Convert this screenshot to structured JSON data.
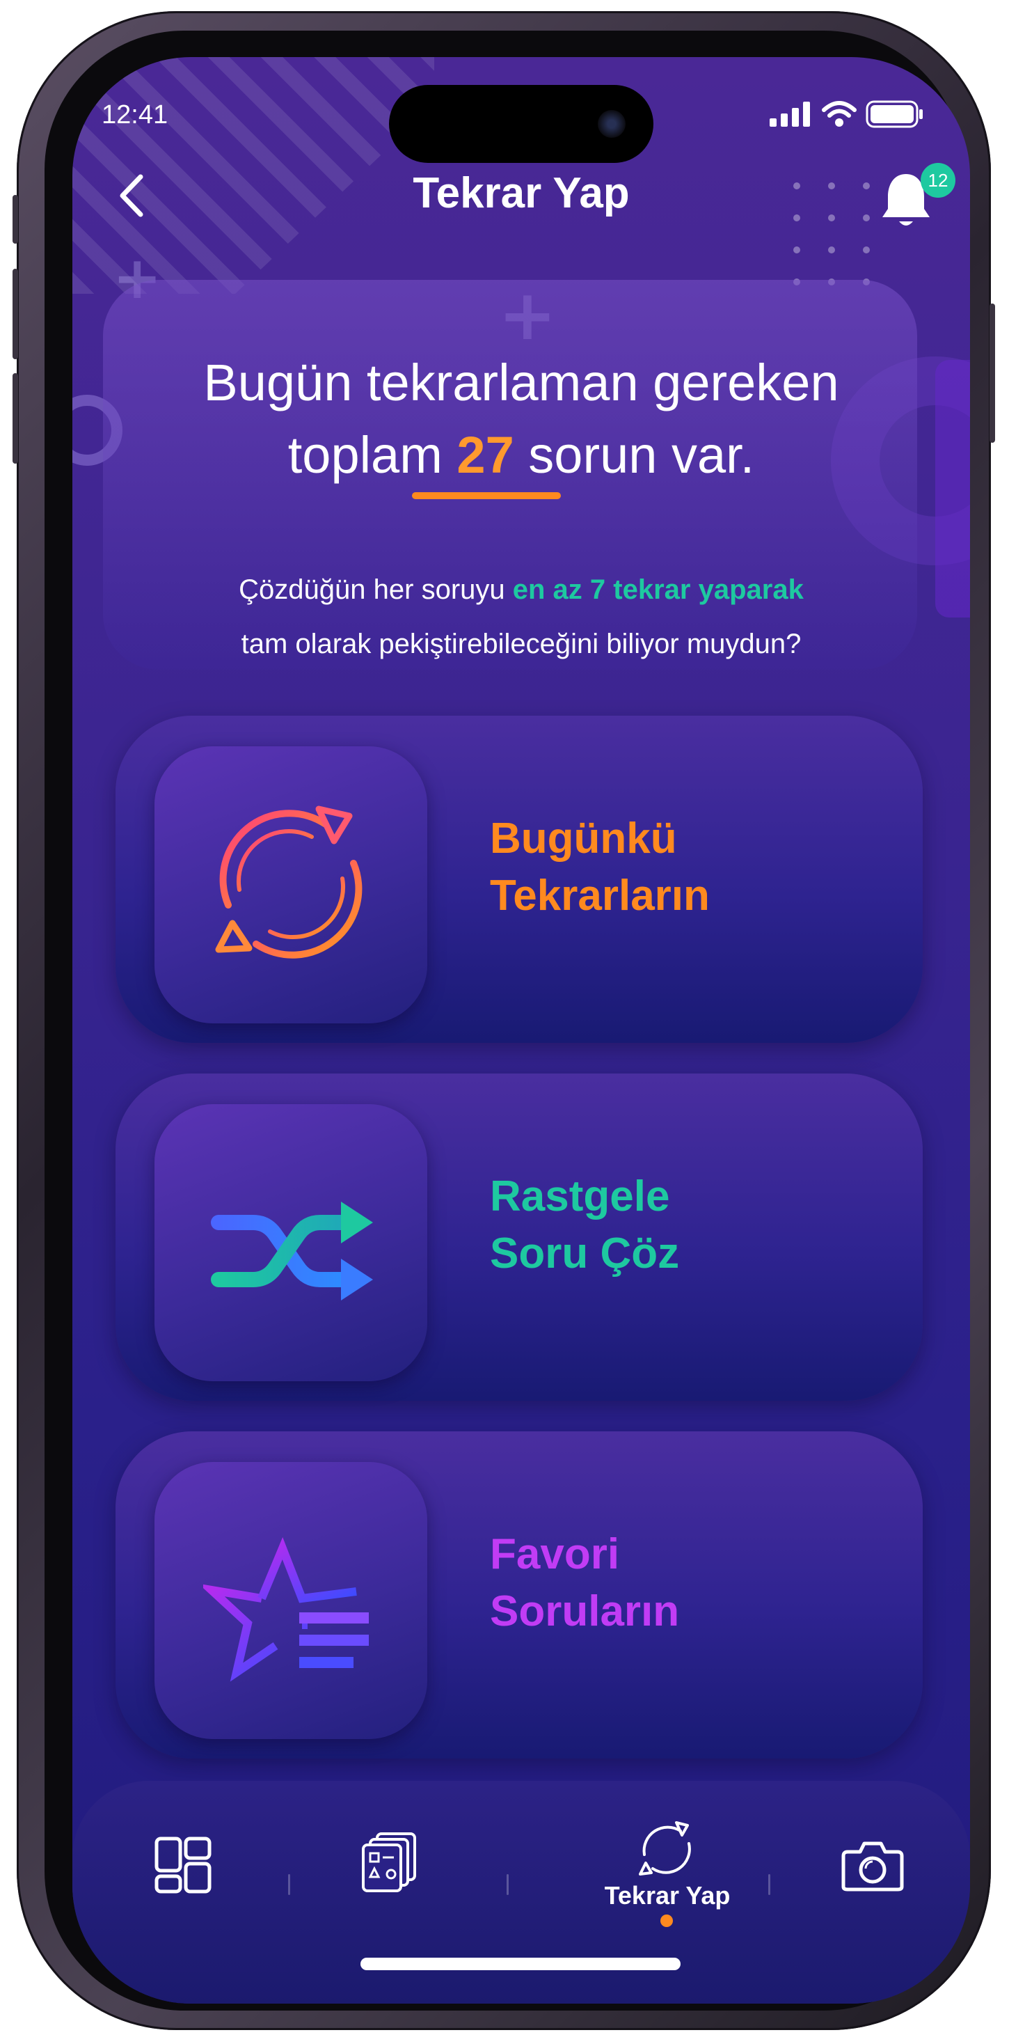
{
  "status_bar": {
    "time": "12:41"
  },
  "header": {
    "title": "Tekrar Yap",
    "notification_count": "12"
  },
  "intro": {
    "line1": "Bugün tekrarlaman gereken",
    "line2_prefix": "toplam",
    "count": "27",
    "line2_suffix": "sorun var.",
    "tip_prefix": "Çözdüğün her soruyu",
    "tip_highlight": "en az 7 tekrar yaparak",
    "tip_line2": "tam olarak pekiştirebileceğini biliyor muydun?"
  },
  "menu": [
    {
      "line1": "Bugünkü",
      "line2": "Tekrarların",
      "icon": "refresh-icon",
      "color": "#ff8a1f"
    },
    {
      "line1": "Rastgele",
      "line2": "Soru Çöz",
      "icon": "shuffle-icon",
      "color": "#1ec9a0"
    },
    {
      "line1": "Favori",
      "line2": "Soruların",
      "icon": "star-list-icon",
      "color": "#c13cf5"
    }
  ],
  "tabbar": {
    "active_label": "Tekrar Yap",
    "tabs": [
      "dashboard-icon",
      "question-cards-icon",
      "repeat-icon",
      "camera-icon"
    ]
  }
}
